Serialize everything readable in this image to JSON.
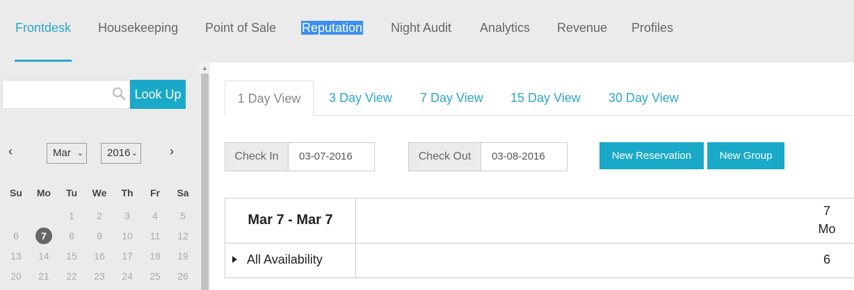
{
  "nav": {
    "items": [
      {
        "label": "Frontdesk"
      },
      {
        "label": "Housekeeping"
      },
      {
        "label": "Point of Sale"
      },
      {
        "label": "Reputation"
      },
      {
        "label": "Night Audit"
      },
      {
        "label": "Analytics"
      },
      {
        "label": "Revenue"
      },
      {
        "label": "Profiles"
      }
    ]
  },
  "search": {
    "value": "",
    "button_label": "Look Up",
    "icon": "search-icon"
  },
  "calendar": {
    "prev": "‹",
    "next": "›",
    "month": "Mar",
    "year": "2016",
    "weekdays": [
      "Su",
      "Mo",
      "Tu",
      "We",
      "Th",
      "Fr",
      "Sa"
    ],
    "rows": [
      [
        "",
        "",
        "1",
        "2",
        "3",
        "4",
        "5"
      ],
      [
        "6",
        "7",
        "8",
        "9",
        "10",
        "11",
        "12"
      ],
      [
        "13",
        "14",
        "15",
        "16",
        "17",
        "18",
        "19"
      ],
      [
        "20",
        "21",
        "22",
        "23",
        "24",
        "25",
        "26"
      ]
    ],
    "selected_day": "7"
  },
  "tabs": [
    {
      "label": "1 Day View"
    },
    {
      "label": "3 Day View"
    },
    {
      "label": "7 Day View"
    },
    {
      "label": "15 Day View"
    },
    {
      "label": "30 Day View"
    }
  ],
  "dates": {
    "check_in_label": "Check In",
    "check_in_value": "03-07-2016",
    "check_out_label": "Check Out",
    "check_out_value": "03-08-2016"
  },
  "actions": {
    "new_reservation": "New Reservation",
    "new_group": "New Group"
  },
  "grid": {
    "range": "Mar 7 - Mar 7",
    "day_number": "7",
    "day_name": "Mo",
    "row_label": "All Availability",
    "row_value": "6"
  },
  "colors": {
    "accent": "#1aa9c8",
    "nav_bg": "#ebebeb",
    "selection": "#3b8ff0"
  }
}
